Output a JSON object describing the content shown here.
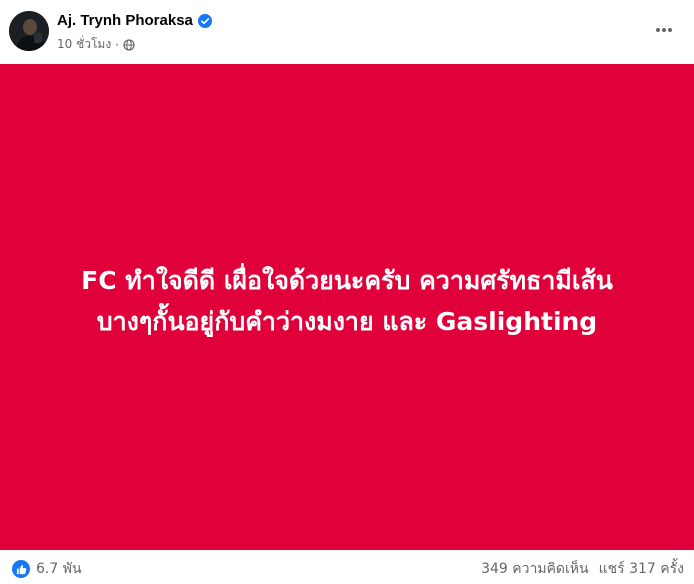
{
  "post": {
    "author": "Aj. Trynh Phoraksa",
    "verified": true,
    "time": "10 ชั่วโมง",
    "privacy_icon": "globe-icon",
    "more_icon": "more-horizontal-icon",
    "text_line_1": "FC ทำใจดีดี เผื่อใจด้วยนะครับ ความศรัทธามีเส้น",
    "text_line_2": "บางๆกั้นอยู่กับคำว่างมงาย และ Gaslighting",
    "background_color": "#e0003a"
  },
  "footer": {
    "reaction_icon": "like-icon",
    "reaction_count": "6.7 พัน",
    "comments": "349 ความคิดเห็น",
    "shares": "แชร์ 317 ครั้ง"
  }
}
